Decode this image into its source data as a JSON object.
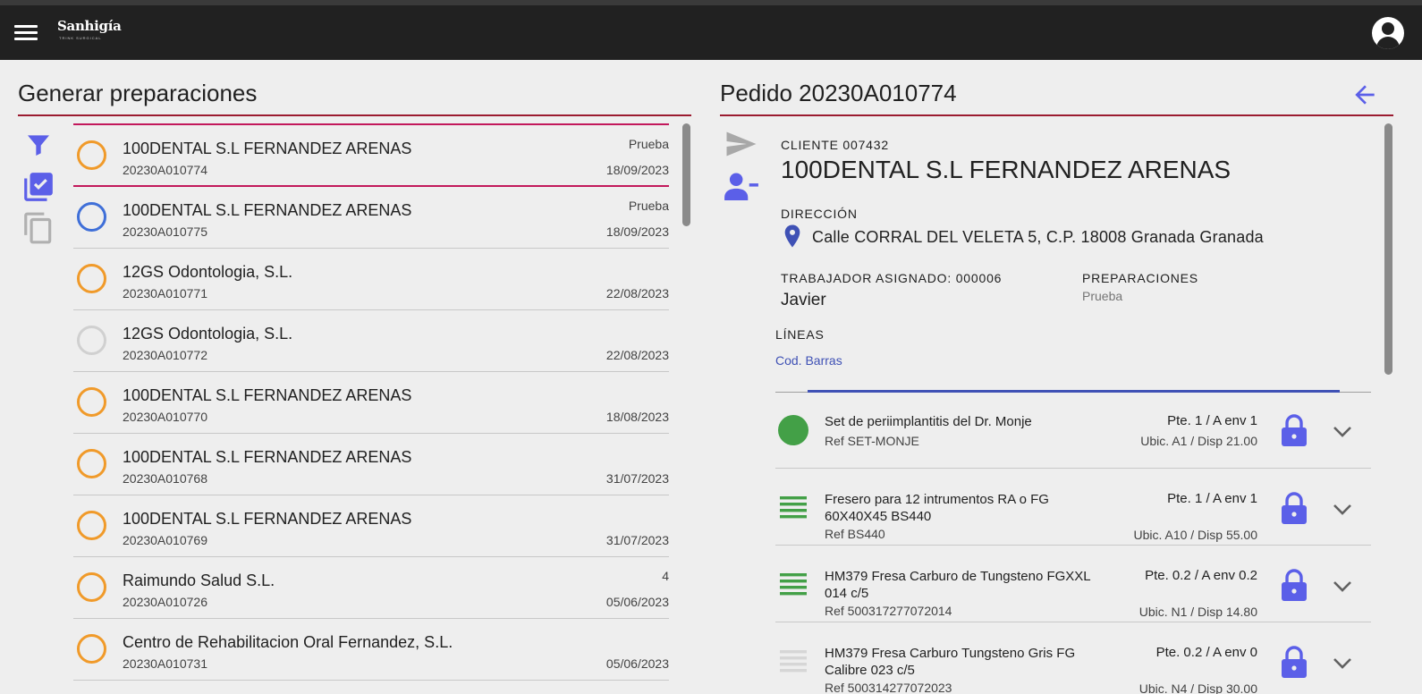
{
  "app": {
    "logo_text": "Sanhigía",
    "logo_subtext": "TRINK SURGICAL"
  },
  "left": {
    "title": "Generar preparaciones",
    "tools": [
      "filter-icon",
      "check-multiple-icon",
      "copy-icon"
    ],
    "orders": [
      {
        "name": "100DENTAL S.L FERNANDEZ ARENAS",
        "code": "20230A010774",
        "tag": "Prueba",
        "date": "18/09/2023",
        "status_color": "#f09a2a"
      },
      {
        "name": "100DENTAL S.L FERNANDEZ ARENAS",
        "code": "20230A010775",
        "tag": "Prueba",
        "date": "18/09/2023",
        "status_color": "#3f6fd8"
      },
      {
        "name": "12GS Odontologia, S.L.",
        "code": "20230A010771",
        "tag": "",
        "date": "22/08/2023",
        "status_color": "#f09a2a"
      },
      {
        "name": "12GS Odontologia, S.L.",
        "code": "20230A010772",
        "tag": "",
        "date": "22/08/2023",
        "status_color": "#d0d0d0"
      },
      {
        "name": "100DENTAL S.L FERNANDEZ ARENAS",
        "code": "20230A010770",
        "tag": "",
        "date": "18/08/2023",
        "status_color": "#f09a2a"
      },
      {
        "name": "100DENTAL S.L FERNANDEZ ARENAS",
        "code": "20230A010768",
        "tag": "",
        "date": "31/07/2023",
        "status_color": "#f09a2a"
      },
      {
        "name": "100DENTAL S.L FERNANDEZ ARENAS",
        "code": "20230A010769",
        "tag": "",
        "date": "31/07/2023",
        "status_color": "#f09a2a"
      },
      {
        "name": "Raimundo Salud S.L.",
        "code": "20230A010726",
        "tag": "4",
        "date": "05/06/2023",
        "status_color": "#f09a2a"
      },
      {
        "name": "Centro de Rehabilitacion Oral Fernandez, S.L.",
        "code": "20230A010731",
        "tag": "",
        "date": "05/06/2023",
        "status_color": "#f09a2a"
      }
    ]
  },
  "detail": {
    "title": "Pedido 20230A010774",
    "client_label": "CLIENTE 007432",
    "client_name": "100DENTAL S.L FERNANDEZ ARENAS",
    "address_label": "DIRECCIÓN",
    "address": "Calle CORRAL DEL VELETA 5, C.P. 18008 Granada Granada",
    "worker_label": "TRABAJADOR ASIGNADO: 000006",
    "worker_name": "Javier",
    "preps_label": "PREPARACIONES",
    "preps_value": "Prueba",
    "lines_label": "LÍNEAS",
    "tab_label": "Cod. Barras",
    "lines": [
      {
        "desc": "Set de periimplantitis del Dr. Monje",
        "ref": "Ref SET-MONJE",
        "pte": "Pte. 1 / A env 1",
        "ubic": "Ubic. A1 / Disp 21.00",
        "icon": "filled-circle-icon",
        "color": "#43a047"
      },
      {
        "desc": "Fresero para 12 intrumentos RA o FG 60X40X45 BS440",
        "ref": "Ref BS440",
        "pte": "Pte. 1 / A env 1",
        "ubic": "Ubic. A10 / Disp 55.00",
        "icon": "lines-icon",
        "color": "#43a047"
      },
      {
        "desc": "HM379 Fresa Carburo de Tungsteno FGXXL 014 c/5",
        "ref": "Ref 500317277072014",
        "pte": "Pte. 0.2 / A env 0.2",
        "ubic": "Ubic. N1 / Disp 14.80",
        "icon": "lines-icon",
        "color": "#43a047"
      },
      {
        "desc": "HM379 Fresa Carburo Tungsteno Gris FG Calibre 023 c/5",
        "ref": "Ref 500314277072023",
        "pte": "Pte. 0.2 / A env 0",
        "ubic": "Ubic. N4 / Disp 30.00",
        "icon": "lines-icon",
        "color": "#d6d6d6"
      }
    ]
  },
  "colors": {
    "accent": "#5b5fe8",
    "rule": "#9b1b30",
    "selected": "#c2185b"
  }
}
